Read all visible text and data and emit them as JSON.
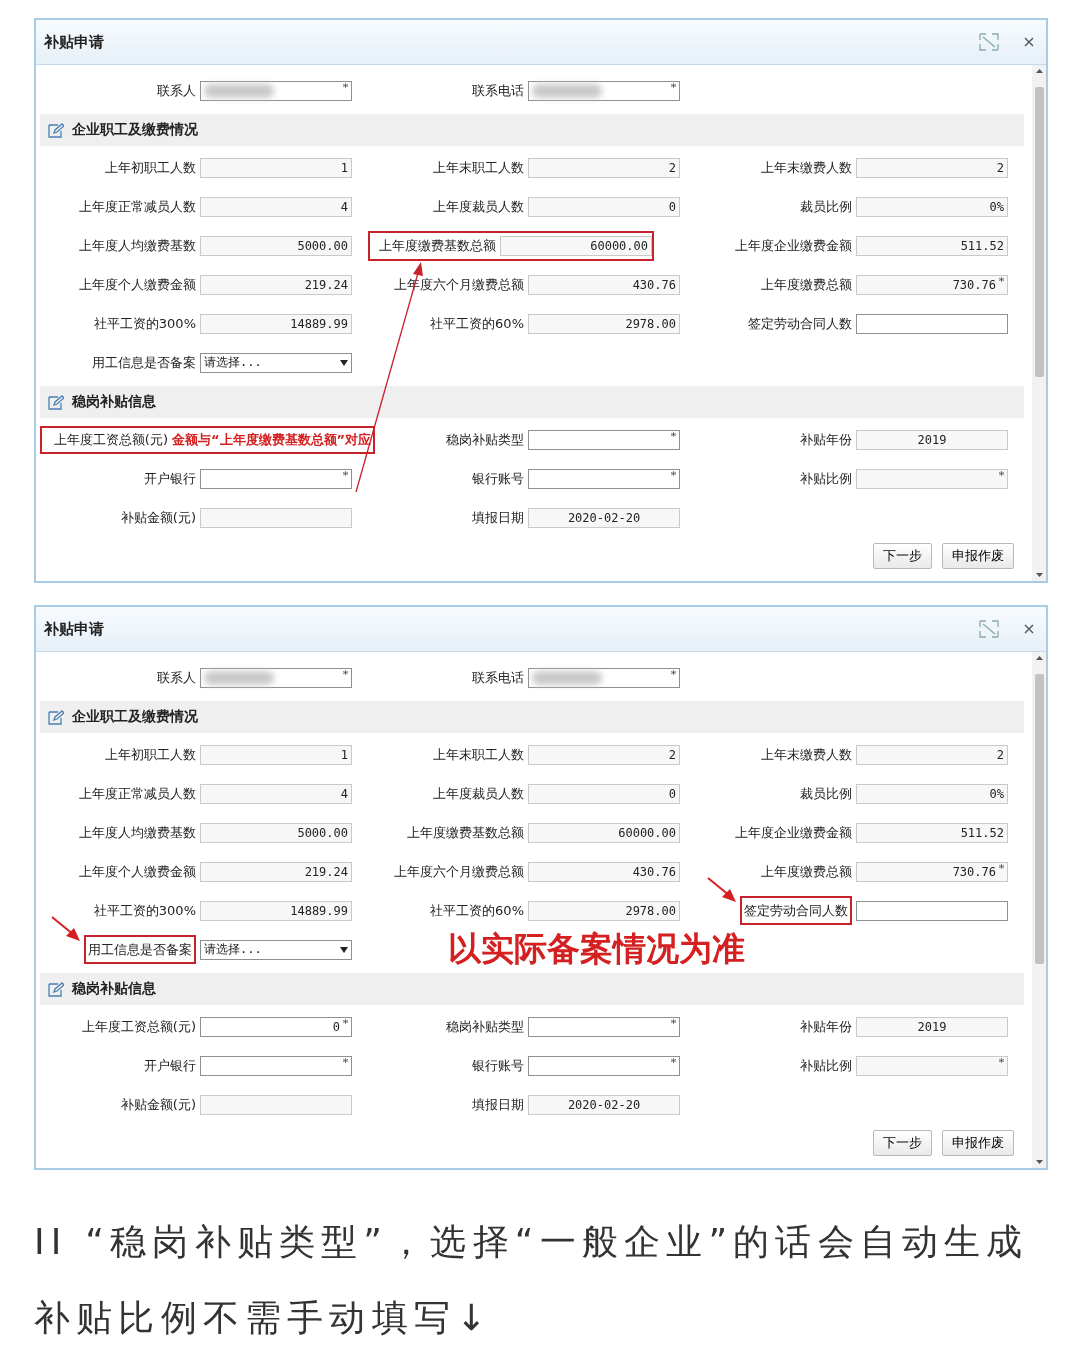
{
  "dialogs": [
    {
      "title": "补贴申请",
      "link_arrow": true,
      "contacts": [
        {
          "label": "联系人",
          "kind": "blurred",
          "required": true
        },
        {
          "label": "联系电话",
          "kind": "blurred",
          "required": true
        }
      ],
      "sections": [
        {
          "title": "企业职工及缴费情况",
          "fields": [
            {
              "label": "上年初职工人数",
              "value": "1",
              "kind": "input",
              "editable": false,
              "required": false,
              "highlighted": false,
              "arrow": false
            },
            {
              "label": "上年末职工人数",
              "value": "2",
              "kind": "input",
              "editable": false,
              "required": false,
              "highlighted": false,
              "arrow": false
            },
            {
              "label": "上年末缴费人数",
              "value": "2",
              "kind": "input",
              "editable": false,
              "required": false,
              "highlighted": false,
              "arrow": false
            },
            {
              "label": "上年度正常减员人数",
              "value": "4",
              "kind": "input",
              "editable": false,
              "required": false,
              "highlighted": false,
              "arrow": false
            },
            {
              "label": "上年度裁员人数",
              "value": "0",
              "kind": "input",
              "editable": false,
              "required": false,
              "highlighted": false,
              "arrow": false
            },
            {
              "label": "裁员比例",
              "value": "0%",
              "kind": "input",
              "editable": false,
              "required": false,
              "highlighted": false,
              "arrow": false
            },
            {
              "label": "上年度人均缴费基数",
              "value": "5000.00",
              "kind": "input",
              "editable": false,
              "required": false,
              "highlighted": false,
              "arrow": false
            },
            {
              "label": "上年度缴费基数总额",
              "value": "60000.00",
              "kind": "input",
              "editable": false,
              "required": false,
              "highlighted": true,
              "arrow": false
            },
            {
              "label": "上年度企业缴费金额",
              "value": "511.52",
              "kind": "input",
              "editable": false,
              "required": false,
              "highlighted": false,
              "arrow": false
            },
            {
              "label": "上年度个人缴费金额",
              "value": "219.24",
              "kind": "input",
              "editable": false,
              "required": false,
              "highlighted": false,
              "arrow": false
            },
            {
              "label": "上年度六个月缴费总额",
              "value": "430.76",
              "kind": "input",
              "editable": false,
              "required": false,
              "highlighted": false,
              "arrow": false
            },
            {
              "label": "上年度缴费总额",
              "value": "730.76",
              "kind": "input",
              "editable": false,
              "required": true,
              "highlighted": false,
              "arrow": false
            },
            {
              "label": "社平工资的300%",
              "value": "14889.99",
              "kind": "input",
              "editable": false,
              "required": false,
              "highlighted": false,
              "arrow": false
            },
            {
              "label": "社平工资的60%",
              "value": "2978.00",
              "kind": "input",
              "editable": false,
              "required": false,
              "highlighted": false,
              "arrow": false
            },
            {
              "label": "签定劳动合同人数",
              "kind": "input",
              "editable": true,
              "required": false,
              "highlighted": false,
              "arrow": false
            },
            {
              "label": "用工信息是否备案",
              "value": "请选择...",
              "kind": "select",
              "editable": true,
              "required": false,
              "highlighted": false,
              "arrow": false
            }
          ]
        },
        {
          "title": "稳岗补贴信息",
          "fields": [
            {
              "label": "上年度工资总额(元)",
              "value": "金额与“上年度缴费基数总额”对应",
              "kind": "callout",
              "highlighted": true,
              "arrow": false
            },
            {
              "label": "稳岗补贴类型",
              "kind": "input",
              "editable": true,
              "required": true,
              "highlighted": false,
              "arrow": false
            },
            {
              "label": "补贴年份",
              "value": "2019",
              "kind": "input",
              "editable": false,
              "required": false,
              "highlighted": false,
              "arrow": false
            },
            {
              "label": "开户银行",
              "kind": "input",
              "editable": true,
              "required": true,
              "highlighted": false,
              "arrow": false
            },
            {
              "label": "银行账号",
              "kind": "input",
              "editable": true,
              "required": true,
              "highlighted": false,
              "arrow": false
            },
            {
              "label": "补贴比例",
              "kind": "input",
              "editable": false,
              "required": true,
              "highlighted": false,
              "arrow": false
            },
            {
              "label": "补贴金额(元)",
              "kind": "input",
              "editable": false,
              "required": false,
              "highlighted": false,
              "arrow": false
            },
            {
              "label": "填报日期",
              "value": "2020-02-20",
              "kind": "input",
              "editable": false,
              "required": false,
              "highlighted": false,
              "arrow": false
            }
          ]
        }
      ],
      "buttons": [
        "下一步",
        "申报作废"
      ]
    },
    {
      "title": "补贴申请",
      "link_arrow": false,
      "contacts": [
        {
          "label": "联系人",
          "kind": "blurred",
          "required": true
        },
        {
          "label": "联系电话",
          "kind": "blurred",
          "required": true
        }
      ],
      "sections": [
        {
          "title": "企业职工及缴费情况",
          "note": "以实际备案情况为准",
          "fields": [
            {
              "label": "上年初职工人数",
              "value": "1",
              "kind": "input",
              "editable": false,
              "required": false,
              "highlighted": false,
              "arrow": false
            },
            {
              "label": "上年末职工人数",
              "value": "2",
              "kind": "input",
              "editable": false,
              "required": false,
              "highlighted": false,
              "arrow": false
            },
            {
              "label": "上年末缴费人数",
              "value": "2",
              "kind": "input",
              "editable": false,
              "required": false,
              "highlighted": false,
              "arrow": false
            },
            {
              "label": "上年度正常减员人数",
              "value": "4",
              "kind": "input",
              "editable": false,
              "required": false,
              "highlighted": false,
              "arrow": false
            },
            {
              "label": "上年度裁员人数",
              "value": "0",
              "kind": "input",
              "editable": false,
              "required": false,
              "highlighted": false,
              "arrow": false
            },
            {
              "label": "裁员比例",
              "value": "0%",
              "kind": "input",
              "editable": false,
              "required": false,
              "highlighted": false,
              "arrow": false
            },
            {
              "label": "上年度人均缴费基数",
              "value": "5000.00",
              "kind": "input",
              "editable": false,
              "required": false,
              "highlighted": false,
              "arrow": false
            },
            {
              "label": "上年度缴费基数总额",
              "value": "60000.00",
              "kind": "input",
              "editable": false,
              "required": false,
              "highlighted": false,
              "arrow": false
            },
            {
              "label": "上年度企业缴费金额",
              "value": "511.52",
              "kind": "input",
              "editable": false,
              "required": false,
              "highlighted": false,
              "arrow": false
            },
            {
              "label": "上年度个人缴费金额",
              "value": "219.24",
              "kind": "input",
              "editable": false,
              "required": false,
              "highlighted": false,
              "arrow": false
            },
            {
              "label": "上年度六个月缴费总额",
              "value": "430.76",
              "kind": "input",
              "editable": false,
              "required": false,
              "highlighted": false,
              "arrow": false
            },
            {
              "label": "上年度缴费总额",
              "value": "730.76",
              "kind": "input",
              "editable": false,
              "required": true,
              "highlighted": false,
              "arrow": false
            },
            {
              "label": "社平工资的300%",
              "value": "14889.99",
              "kind": "input",
              "editable": false,
              "required": false,
              "highlighted": false,
              "arrow": false
            },
            {
              "label": "社平工资的60%",
              "value": "2978.00",
              "kind": "input",
              "editable": false,
              "required": false,
              "highlighted": false,
              "arrow": false
            },
            {
              "label": "签定劳动合同人数",
              "kind": "input",
              "editable": true,
              "required": false,
              "highlighted": true,
              "arrow": true
            },
            {
              "label": "用工信息是否备案",
              "value": "请选择...",
              "kind": "select",
              "editable": true,
              "required": false,
              "highlighted": true,
              "arrow": true
            }
          ]
        },
        {
          "title": "稳岗补贴信息",
          "fields": [
            {
              "label": "上年度工资总额(元)",
              "value": "0",
              "kind": "input",
              "editable": true,
              "required": true,
              "highlighted": false,
              "arrow": false
            },
            {
              "label": "稳岗补贴类型",
              "kind": "input",
              "editable": true,
              "required": true,
              "highlighted": false,
              "arrow": false
            },
            {
              "label": "补贴年份",
              "value": "2019",
              "kind": "input",
              "editable": false,
              "required": false,
              "highlighted": false,
              "arrow": false
            },
            {
              "label": "开户银行",
              "kind": "input",
              "editable": true,
              "required": true,
              "highlighted": false,
              "arrow": false
            },
            {
              "label": "银行账号",
              "kind": "input",
              "editable": true,
              "required": true,
              "highlighted": false,
              "arrow": false
            },
            {
              "label": "补贴比例",
              "kind": "input",
              "editable": false,
              "required": true,
              "highlighted": false,
              "arrow": false
            },
            {
              "label": "补贴金额(元)",
              "kind": "input",
              "editable": false,
              "required": false,
              "highlighted": false,
              "arrow": false
            },
            {
              "label": "填报日期",
              "value": "2020-02-20",
              "kind": "input",
              "editable": false,
              "required": false,
              "highlighted": false,
              "arrow": false
            }
          ]
        }
      ],
      "buttons": [
        "下一步",
        "申报作废"
      ]
    }
  ],
  "caption": "II “稳岗补贴类型”，选择“一般企业”的话会自动生成补贴比例不需手动填写↓"
}
